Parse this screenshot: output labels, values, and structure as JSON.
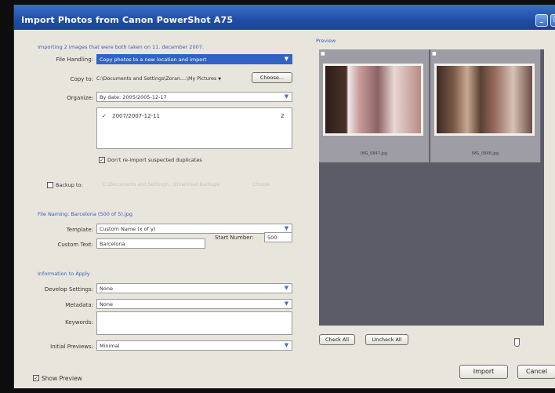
{
  "window": {
    "title": "Import Photos from Canon PowerShot A75",
    "minimize_glyph": "_",
    "restore_glyph": "□"
  },
  "info_line": "Importing 2 images that were both taken on 11. december 2007.",
  "file_handling": {
    "label": "File Handling:",
    "value": "Copy photos to a new location and import"
  },
  "copy_to": {
    "label": "Copy to:",
    "path": "C:\\Documents and Settings\\Zoran....\\My Pictures",
    "choose_label": "Choose..."
  },
  "organize": {
    "label": "Organize:",
    "value": "By date: 2005/2005-12-17"
  },
  "folders": [
    {
      "name": "2007/2007-12-11",
      "count": "2",
      "checked": true
    }
  ],
  "dont_reimport": {
    "label": "Don't re-import suspected duplicates",
    "checked": true
  },
  "backup": {
    "label": "Backup to:",
    "path": "C:\\Documents and Settings\\...\\Download Backups",
    "choose_label": "Choose",
    "checked": false
  },
  "file_naming": {
    "section": "File Naming: Barcelona (500 of 5).jpg",
    "template_label": "Template:",
    "template_value": "Custom Name (x of y)",
    "custom_text_label": "Custom Text:",
    "custom_text_value": "Barcelona",
    "start_number_label": "Start Number:",
    "start_number_value": "500"
  },
  "apply": {
    "section": "Information to Apply",
    "develop_label": "Develop Settings:",
    "develop_value": "None",
    "metadata_label": "Metadata:",
    "metadata_value": "None",
    "keywords_label": "Keywords:",
    "keywords_value": "",
    "initial_previews_label": "Initial Previews:",
    "initial_previews_value": "Minimal"
  },
  "preview": {
    "label": "Preview",
    "thumbnails": [
      {
        "filename": "IMG_0847.jpg",
        "checked": true
      },
      {
        "filename": "IMG_0848.jpg",
        "checked": true
      }
    ],
    "check_all_label": "Check All",
    "uncheck_all_label": "Uncheck All"
  },
  "show_preview": {
    "label": "Show Preview",
    "checked": true
  },
  "buttons": {
    "import": "Import",
    "cancel": "Cancel"
  },
  "colors": {
    "title_bar": "#1f4ea8",
    "dialog_bg": "#e8e5dd",
    "preview_bg": "#5b5c68",
    "selection": "#3163c4",
    "section_text": "#3a5fb5"
  },
  "icons": {
    "dropdown": "chevron-down-icon",
    "check": "checkmark-icon",
    "thumbnail_badge": "check-badge-icon"
  }
}
